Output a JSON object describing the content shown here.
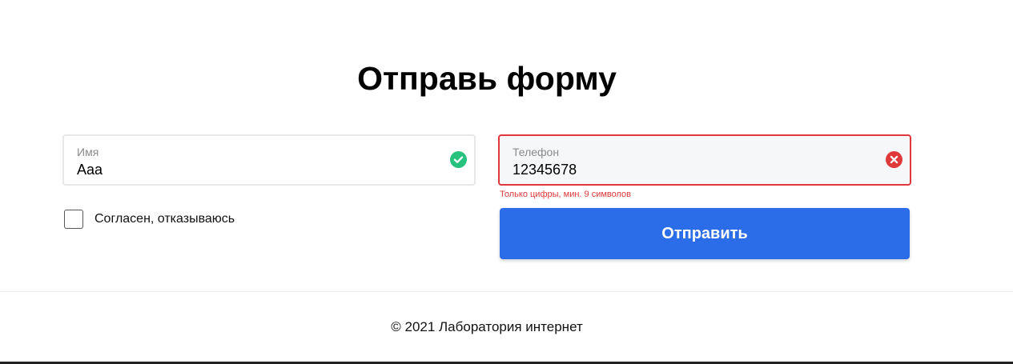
{
  "form": {
    "title": "Отправь форму",
    "name_field": {
      "label": "Имя",
      "value": "Aaa",
      "status": "valid"
    },
    "phone_field": {
      "label": "Телефон",
      "value": "12345678",
      "status": "invalid",
      "error": "Только цифры, мин. 9 символов"
    },
    "consent": {
      "label": "Согласен, отказываюсь",
      "checked": false
    },
    "submit_label": "Отправить"
  },
  "footer": {
    "text": "© 2021 Лаборатория интернет"
  },
  "colors": {
    "accent": "#2b6ce8",
    "valid": "#27c27e",
    "error": "#e0393b"
  },
  "icons": {
    "valid": "check-circle-icon",
    "invalid": "close-circle-icon"
  }
}
